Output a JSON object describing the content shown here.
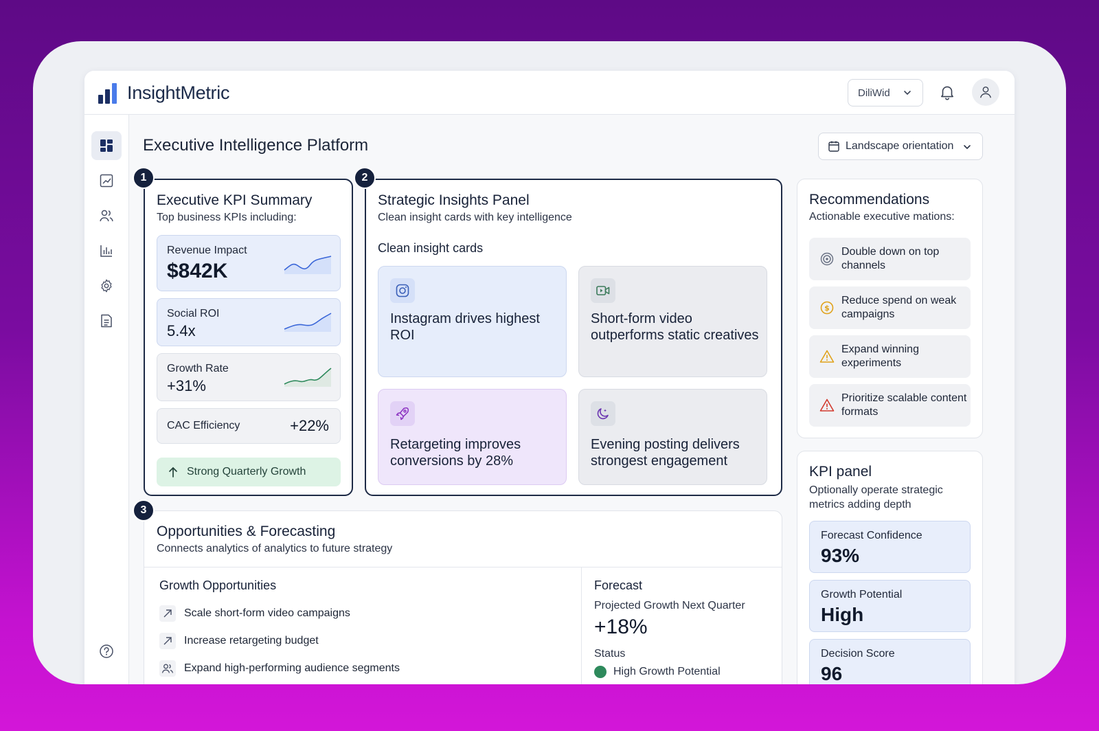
{
  "app": {
    "brand": "InsightMetric",
    "brand_select_value": "DiliWid"
  },
  "colors": {
    "accent": "#2f5bd6",
    "dark_outline": "#1d2a46",
    "positive": "#2e8a5c",
    "warning": "#e0a21a",
    "danger": "#d23a2e"
  },
  "sidebar": {
    "items": [
      {
        "icon": "dashboard-icon",
        "active": true
      },
      {
        "icon": "trend-chart-icon"
      },
      {
        "icon": "users-icon"
      },
      {
        "icon": "bar-chart-icon"
      },
      {
        "icon": "gear-icon"
      },
      {
        "icon": "document-icon"
      }
    ],
    "help_icon": "help-icon"
  },
  "main": {
    "title": "Executive Intelligence Platform",
    "orientation_select": "Landscape orientation"
  },
  "kpi_summary": {
    "badge": "1",
    "title": "Executive KPI Summary",
    "subtitle": "Top business KPIs including:",
    "cards": [
      {
        "label": "Revenue Impact",
        "value": "$842K"
      },
      {
        "label": "Social ROI",
        "value": "5.4x"
      },
      {
        "label": "Growth Rate",
        "value": "+31%"
      },
      {
        "label": "CAC Efficiency",
        "value": "+22%"
      }
    ],
    "growth_banner": "Strong Quarterly Growth"
  },
  "insights": {
    "badge": "2",
    "title": "Strategic Insights Panel",
    "subtitle": "Clean insight cards with key intelligence",
    "section_label": "Clean insight cards",
    "cards": [
      {
        "icon": "instagram-icon",
        "text": "Instagram drives highest ROI"
      },
      {
        "icon": "video-icon",
        "text": "Short-form video outperforms static creatives"
      },
      {
        "icon": "rocket-icon",
        "text": "Retargeting improves conversions by 28%"
      },
      {
        "icon": "moon-icon",
        "text": "Evening posting delivers strongest engagement"
      }
    ]
  },
  "recommendations": {
    "title": "Recommendations",
    "subtitle": "Actionable executive mations:",
    "items": [
      {
        "icon": "target-icon",
        "text": "Double down on top channels"
      },
      {
        "icon": "dollar-coin-icon",
        "text": "Reduce spend on weak campaigns"
      },
      {
        "icon": "warning-icon",
        "text": "Expand winning experiments"
      },
      {
        "icon": "alert-icon",
        "text": "Prioritize scalable content formats"
      }
    ]
  },
  "kpi_panel": {
    "title": "KPI panel",
    "subtitle": "Optionally operate strategic metrics adding depth",
    "cards": [
      {
        "label": "Forecast Confidence",
        "value": "93%"
      },
      {
        "label": "Growth Potential",
        "value": "High"
      },
      {
        "label": "Decision Score",
        "value": "96"
      }
    ]
  },
  "opportunities": {
    "badge": "3",
    "title": "Opportunities & Forecasting",
    "subtitle": "Connects analytics of analytics to future strategy",
    "growth_title": "Growth Opportunities",
    "items": [
      {
        "icon": "arrow-up-right-icon",
        "text": "Scale short-form video campaigns"
      },
      {
        "icon": "arrow-up-right-icon",
        "text": "Increase retargeting budget"
      },
      {
        "icon": "audience-icon",
        "text": "Expand high-performing audience segments"
      }
    ],
    "forecast": {
      "title": "Forecast",
      "label": "Projected Growth Next Quarter",
      "value": "+18%",
      "status_label": "Status",
      "status_value": "High Growth Potential"
    }
  }
}
